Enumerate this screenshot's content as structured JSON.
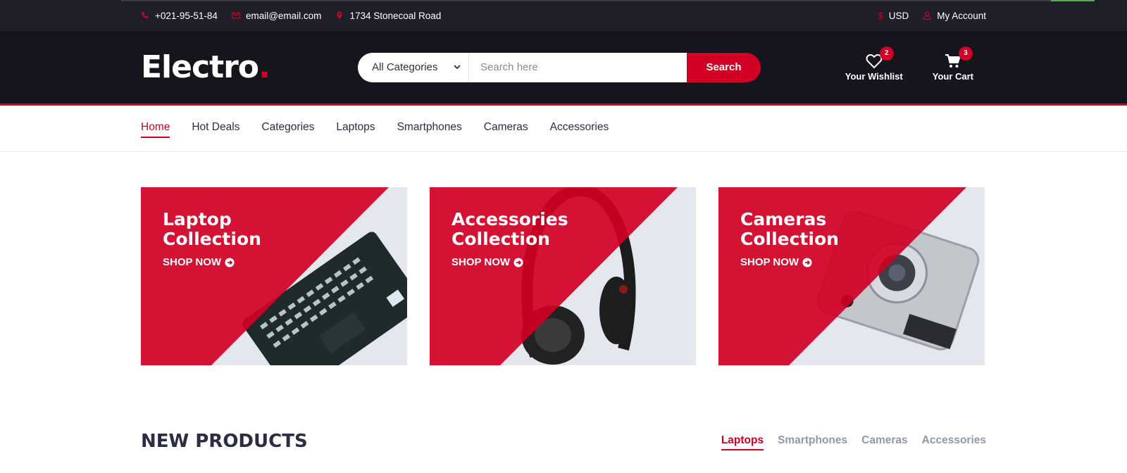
{
  "topbar": {
    "phone": "+021-95-51-84",
    "email": "email@email.com",
    "address": "1734 Stonecoal Road",
    "currency": "USD",
    "account": "My Account"
  },
  "header": {
    "logo_text": "Electro",
    "logo_dot": ".",
    "category_select": "All Categories",
    "search_placeholder": "Search here",
    "search_button": "Search",
    "wishlist_label": "Your Wishlist",
    "wishlist_count": "2",
    "cart_label": "Your Cart",
    "cart_count": "3"
  },
  "nav": {
    "items": [
      "Home",
      "Hot Deals",
      "Categories",
      "Laptops",
      "Smartphones",
      "Cameras",
      "Accessories"
    ],
    "active": "Home"
  },
  "collections": [
    {
      "line1": "Laptop",
      "line2": "Collection",
      "cta": "SHOP NOW",
      "icon": "laptop-image"
    },
    {
      "line1": "Accessories",
      "line2": "Collection",
      "cta": "SHOP NOW",
      "icon": "headphones-image"
    },
    {
      "line1": "Cameras",
      "line2": "Collection",
      "cta": "SHOP NOW",
      "icon": "camera-image"
    }
  ],
  "new_products": {
    "title": "NEW PRODUCTS",
    "tabs": [
      "Laptops",
      "Smartphones",
      "Cameras",
      "Accessories"
    ],
    "active_tab": "Laptops"
  },
  "colors": {
    "accent": "#d10024",
    "topbar_bg": "#1e1f29",
    "header_bg": "#15161d",
    "text_dark": "#2b2d42",
    "tab_muted": "#8d99ae"
  }
}
